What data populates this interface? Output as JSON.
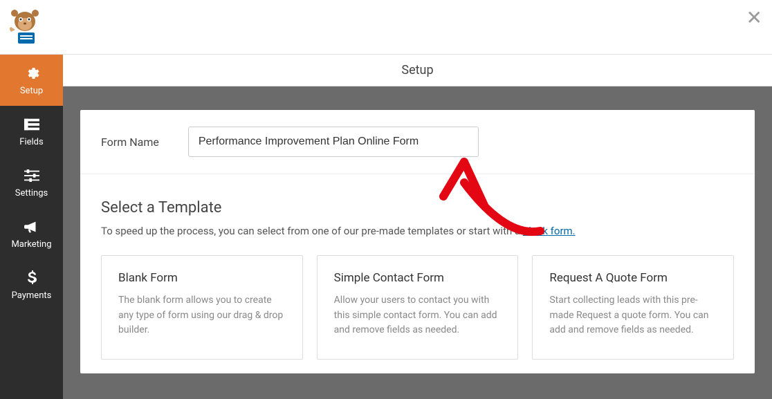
{
  "header": {
    "title": "Setup"
  },
  "sidebar": {
    "items": [
      {
        "label": "Setup",
        "icon": "gear"
      },
      {
        "label": "Fields",
        "icon": "list"
      },
      {
        "label": "Settings",
        "icon": "sliders"
      },
      {
        "label": "Marketing",
        "icon": "megaphone"
      },
      {
        "label": "Payments",
        "icon": "dollar"
      }
    ]
  },
  "form": {
    "name_label": "Form Name",
    "name_value": "Performance Improvement Plan Online Form"
  },
  "templates": {
    "heading": "Select a Template",
    "subheading_prefix": "To speed up the process, you can select from one of our pre-made templates or start with a ",
    "blank_link": "blank form.",
    "cards": [
      {
        "title": "Blank Form",
        "desc": "The blank form allows you to create any type of form using our drag & drop builder."
      },
      {
        "title": "Simple Contact Form",
        "desc": "Allow your users to contact you with this simple contact form. You can add and remove fields as needed."
      },
      {
        "title": "Request A Quote Form",
        "desc": "Start collecting leads with this pre-made Request a quote form. You can add and remove fields as needed."
      }
    ]
  }
}
